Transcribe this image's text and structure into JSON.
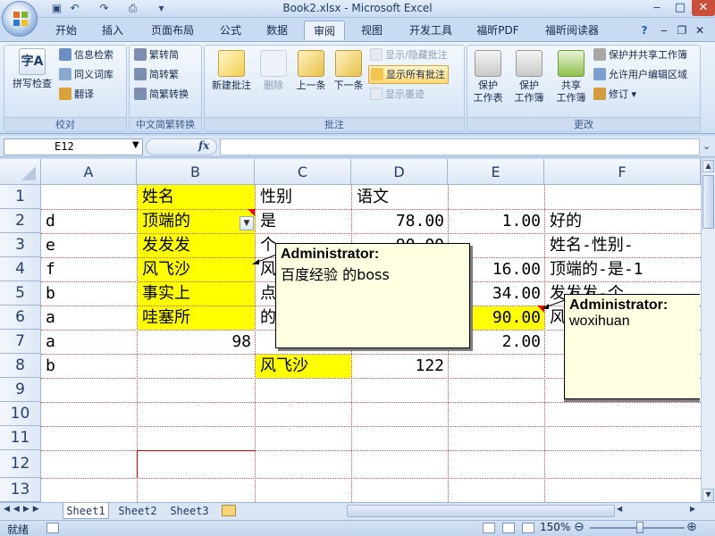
{
  "window": {
    "title": "Book2.xlsx - Microsoft Excel",
    "min_glyph": "‒",
    "max_glyph": "□",
    "close_glyph": "✕"
  },
  "qat": {
    "save_glyph": "▣",
    "undo_glyph": "↶",
    "redo_glyph": "↷",
    "preview_glyph": "⎙",
    "more_glyph": "▾"
  },
  "tabs": [
    "开始",
    "插入",
    "页面布局",
    "公式",
    "数据",
    "审阅",
    "视图",
    "开发工具",
    "福昕PDF",
    "福昕阅读器"
  ],
  "active_tab": "审阅",
  "tabbar_right": {
    "help_glyph": "?",
    "min_glyph": "‒",
    "restore_glyph": "❐",
    "close_glyph": "✕"
  },
  "ribbon": {
    "proofing": {
      "label": "校对",
      "spell": {
        "icon_text": "字A",
        "label": "拼写检查"
      },
      "research": "信息检索",
      "thesaurus": "同义词库",
      "translate": "翻译"
    },
    "chinese_conv": {
      "label": "中文简繁转换",
      "to_trad": "繁转简",
      "to_simp": "简转繁",
      "convert": "简繁转换"
    },
    "comments": {
      "label": "批注",
      "new": "新建批注",
      "delete": "删除",
      "prev": "上一条",
      "next": "下一条",
      "show_hide": "显示/隐藏批注",
      "show_all": "显示所有批注",
      "show_ink": "显示墨迹"
    },
    "changes": {
      "label": "更改",
      "protect_sheet": {
        "line1": "保护",
        "line2": "工作表"
      },
      "protect_book": {
        "line1": "保护",
        "line2": "工作簿"
      },
      "share_book": {
        "line1": "共享",
        "line2": "工作簿"
      },
      "protect_share": "保护并共享工作簿",
      "allow_edit": "允许用户编辑区域",
      "track": "修订"
    }
  },
  "formula_bar": {
    "name_box": "E12",
    "fx": "fx",
    "content": ""
  },
  "columns": [
    "A",
    "B",
    "C",
    "D",
    "E",
    "F"
  ],
  "rows": [
    "1",
    "2",
    "3",
    "4",
    "5",
    "6",
    "7",
    "8",
    "9",
    "10",
    "11",
    "12",
    "13"
  ],
  "cells": {
    "B1": "姓名",
    "C1": "性别",
    "D1": "语文",
    "A2": "d",
    "B2": "顶端的",
    "C2": "是",
    "D2": "78.00",
    "E2": "1.00",
    "F2": "好的",
    "A3": "e",
    "B3": "发发发",
    "C3": "个",
    "D3": "90.00",
    "F3": "姓名-性别-",
    "A4": "f",
    "B4": "风飞沙",
    "C4": "风",
    "E4": "16.00",
    "F4": "顶端的-是-1",
    "A5": "b",
    "B5": "事实上",
    "C5": "点",
    "E5": "34.00",
    "F5": "发发发-个",
    "A6": "a",
    "B6": "哇塞所",
    "C6": "的",
    "E6": "90.00",
    "F6": "风",
    "A7": "a",
    "B7": "98",
    "E7": "2.00",
    "A8": "b",
    "C8": "风飞沙",
    "D8": "122"
  },
  "comments": [
    {
      "author": "Administrator:",
      "text": "百度经验 的boss"
    },
    {
      "author": "Administrator:",
      "text": "woxihuan"
    }
  ],
  "sheet_tabs": [
    "Sheet1",
    "Sheet2",
    "Sheet3"
  ],
  "status": {
    "ready": "就绪",
    "zoom": "150%",
    "zoom_out": "⊖",
    "zoom_in": "⊕"
  },
  "colors": {
    "yellow": "#ffff00",
    "ribbon_bg": "#dbe8f7",
    "comment_bg": "#ffffe1"
  }
}
